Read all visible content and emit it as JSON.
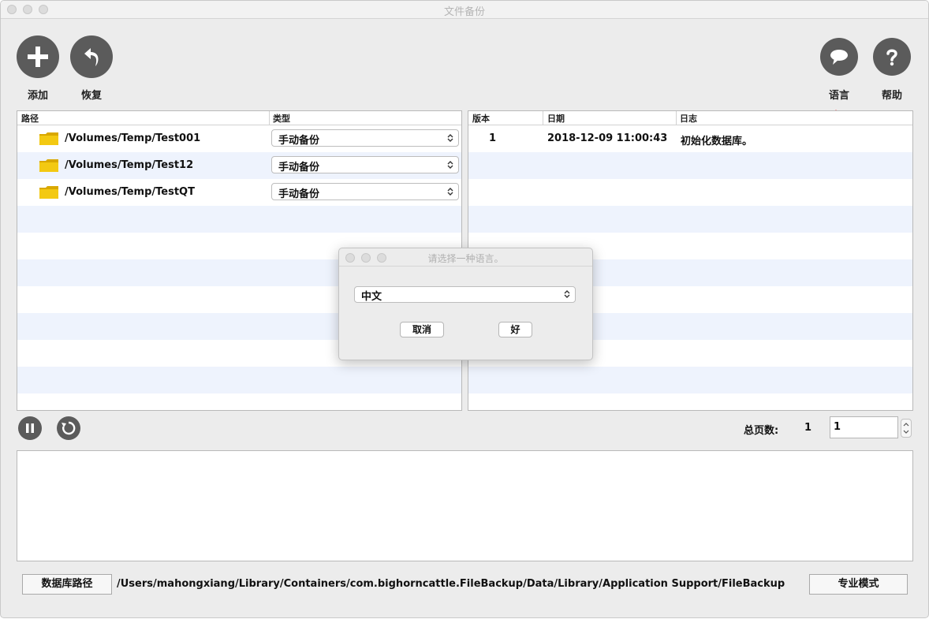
{
  "window": {
    "title": "文件备份"
  },
  "toolbar": {
    "add_label": "添加",
    "restore_label": "恢复",
    "language_label": "语言",
    "help_label": "帮助"
  },
  "paths_table": {
    "headers": {
      "path": "路径",
      "type": "类型"
    },
    "rows": [
      {
        "path": "/Volumes/Temp/Test001",
        "type": "手动备份"
      },
      {
        "path": "/Volumes/Temp/Test12",
        "type": "手动备份"
      },
      {
        "path": "/Volumes/Temp/TestQT",
        "type": "手动备份"
      }
    ]
  },
  "versions_table": {
    "headers": {
      "version": "版本",
      "date": "日期",
      "log": "日志"
    },
    "rows": [
      {
        "version": "1",
        "date": "2018-12-09 11:00:43",
        "log": "初始化数据库。"
      }
    ]
  },
  "pagination": {
    "label": "总页数:",
    "total": "1",
    "current": "1"
  },
  "footer": {
    "db_path_button": "数据库路径",
    "db_path": "/Users/mahongxiang/Library/Containers/com.bighorncattle.FileBackup/Data/Library/Application Support/FileBackup",
    "pro_mode_button": "专业模式"
  },
  "dialog": {
    "title": "请选择一种语言。",
    "selected_language": "中文",
    "cancel_label": "取消",
    "ok_label": "好"
  },
  "colors": {
    "annotation_arrow": "#ff0000",
    "row_alt": "#eef3fd",
    "icon_fill": "#5b5b5b"
  }
}
